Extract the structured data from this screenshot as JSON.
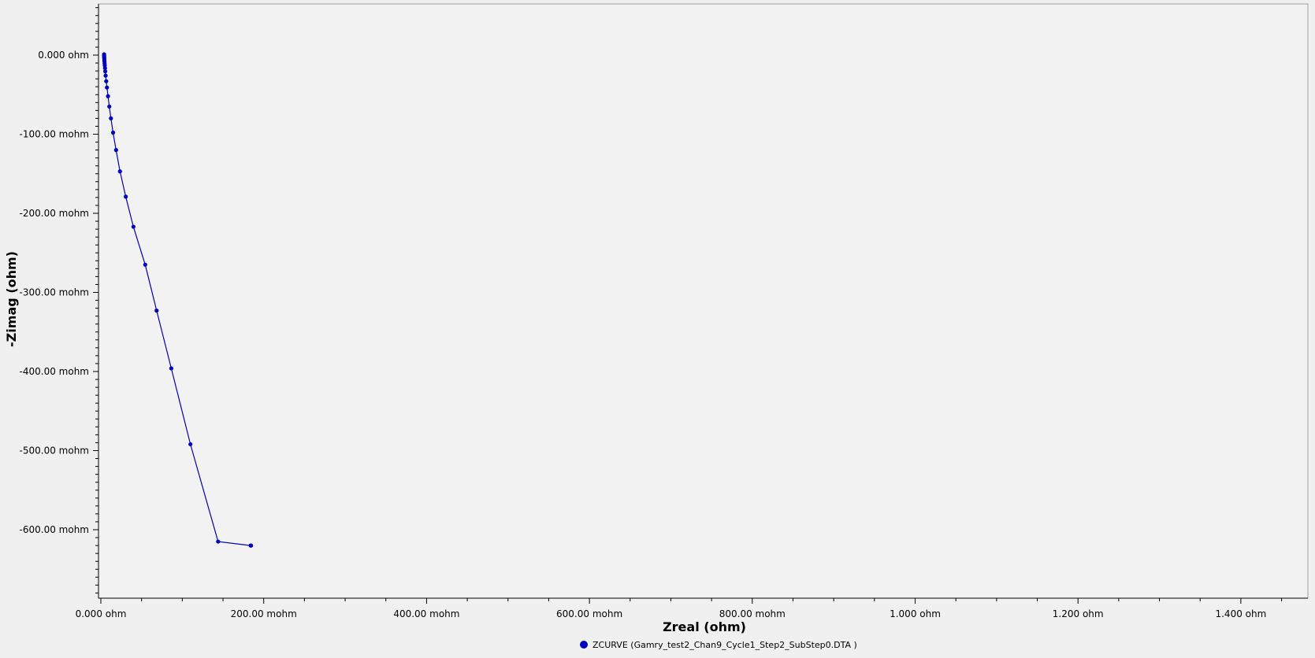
{
  "chart_data": {
    "type": "scatter",
    "title": "",
    "xlabel": "Zreal (ohm)",
    "ylabel": "-Zimag (ohm)",
    "xlim": [
      0,
      1.5
    ],
    "ylim": [
      -0.7,
      0.065
    ],
    "grid": false,
    "legend_position": "bottom",
    "x_ticks": [
      {
        "value": 0,
        "label": "0.000 ohm"
      },
      {
        "value": 0.2,
        "label": "200.00 mohm"
      },
      {
        "value": 0.4,
        "label": "400.00 mohm"
      },
      {
        "value": 0.6,
        "label": "600.00 mohm"
      },
      {
        "value": 0.8,
        "label": "800.00 mohm"
      },
      {
        "value": 1.0,
        "label": "1.000 ohm"
      },
      {
        "value": 1.2,
        "label": "1.200 ohm"
      },
      {
        "value": 1.4,
        "label": "1.400 ohm"
      }
    ],
    "y_ticks": [
      {
        "value": 0,
        "label": "0.000 ohm"
      },
      {
        "value": -0.1,
        "label": "-100.00 mohm"
      },
      {
        "value": -0.2,
        "label": "-200.00 mohm"
      },
      {
        "value": -0.3,
        "label": "-300.00 mohm"
      },
      {
        "value": -0.4,
        "label": "-400.00 mohm"
      },
      {
        "value": -0.5,
        "label": "-500.00 mohm"
      },
      {
        "value": -0.6,
        "label": "-600.00 mohm"
      }
    ],
    "series": [
      {
        "name": "ZCURVE (Gamry_test2_Chan9_Cycle1_Step2_SubStep0.DTA )",
        "color": "#0000c0",
        "x": [
          0.004,
          0.004,
          0.0041,
          0.0041,
          0.0042,
          0.0043,
          0.0044,
          0.0046,
          0.0048,
          0.0051,
          0.0054,
          0.0059,
          0.0066,
          0.0075,
          0.0088,
          0.0104,
          0.0124,
          0.015,
          0.0187,
          0.0235,
          0.0306,
          0.04,
          0.0545,
          0.0685,
          0.0865,
          0.11,
          0.144,
          0.184,
          0.1845
        ],
        "y": [
          0.001,
          0.0,
          -0.001,
          -0.0025,
          -0.004,
          -0.006,
          -0.008,
          -0.0105,
          -0.013,
          -0.0165,
          -0.0205,
          -0.026,
          -0.033,
          -0.041,
          -0.052,
          -0.065,
          -0.08,
          -0.098,
          -0.12,
          -0.147,
          -0.179,
          -0.217,
          -0.265,
          -0.323,
          -0.396,
          -0.492,
          -0.615,
          -0.62,
          -0.62
        ]
      }
    ]
  }
}
